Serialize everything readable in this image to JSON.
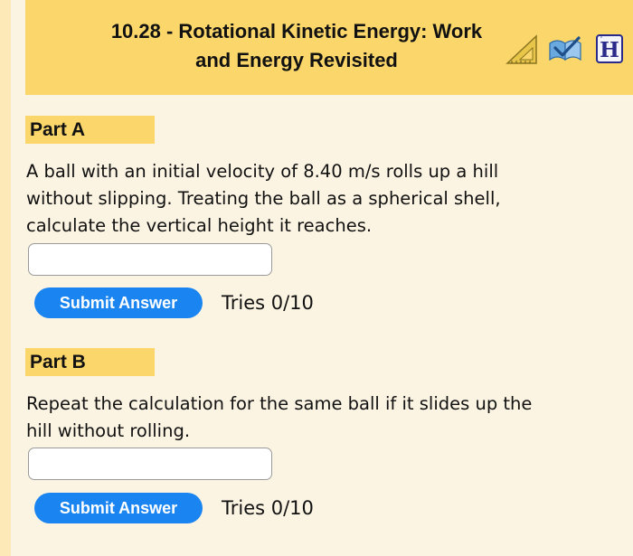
{
  "header": {
    "title_line1": "10.28 - Rotational Kinetic Energy: Work",
    "title_line2": "and Energy Revisited",
    "icons": [
      "ruler-triangle-icon",
      "book-checkmark-icon",
      "h-hint-icon"
    ]
  },
  "parts": [
    {
      "label": "Part A",
      "question_line1": "A ball with an initial velocity of 8.40 m/s rolls up a hill",
      "question_line2": "without slipping. Treating the ball as a spherical shell,",
      "question_line3": "calculate the vertical height it reaches.",
      "answer_value": "",
      "submit_label": "Submit Answer",
      "tries": "Tries 0/10"
    },
    {
      "label": "Part B",
      "question_line1": "Repeat the calculation for the same ball if it slides up the",
      "question_line2": "hill without rolling.",
      "answer_value": "",
      "submit_label": "Submit Answer",
      "tries": "Tries 0/10"
    }
  ],
  "colors": {
    "header_bg": "#fbd76b",
    "page_bg": "#fcf4e3",
    "button_bg": "#1a84f1"
  }
}
